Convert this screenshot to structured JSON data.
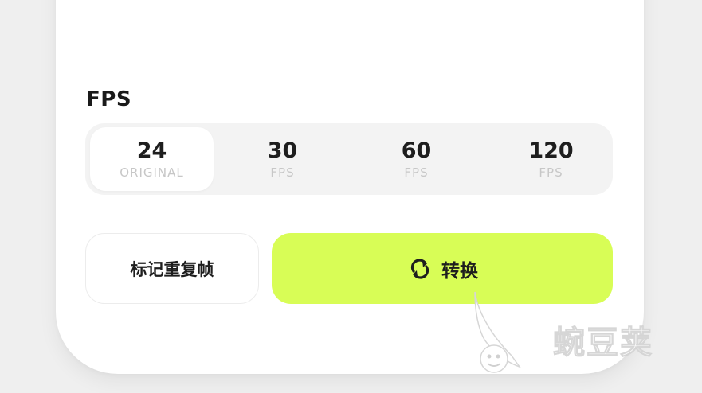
{
  "fps_section": {
    "label": "FPS",
    "options": [
      {
        "value": "24",
        "sub": "ORIGINAL",
        "selected": true
      },
      {
        "value": "30",
        "sub": "FPS",
        "selected": false
      },
      {
        "value": "60",
        "sub": "FPS",
        "selected": false
      },
      {
        "value": "120",
        "sub": "FPS",
        "selected": false
      }
    ]
  },
  "actions": {
    "mark_label": "标记重复帧",
    "convert_label": "转换",
    "convert_icon": "convert-icon",
    "convert_color": "#d8fd56"
  },
  "watermark": {
    "text": "蜿豆荚"
  }
}
